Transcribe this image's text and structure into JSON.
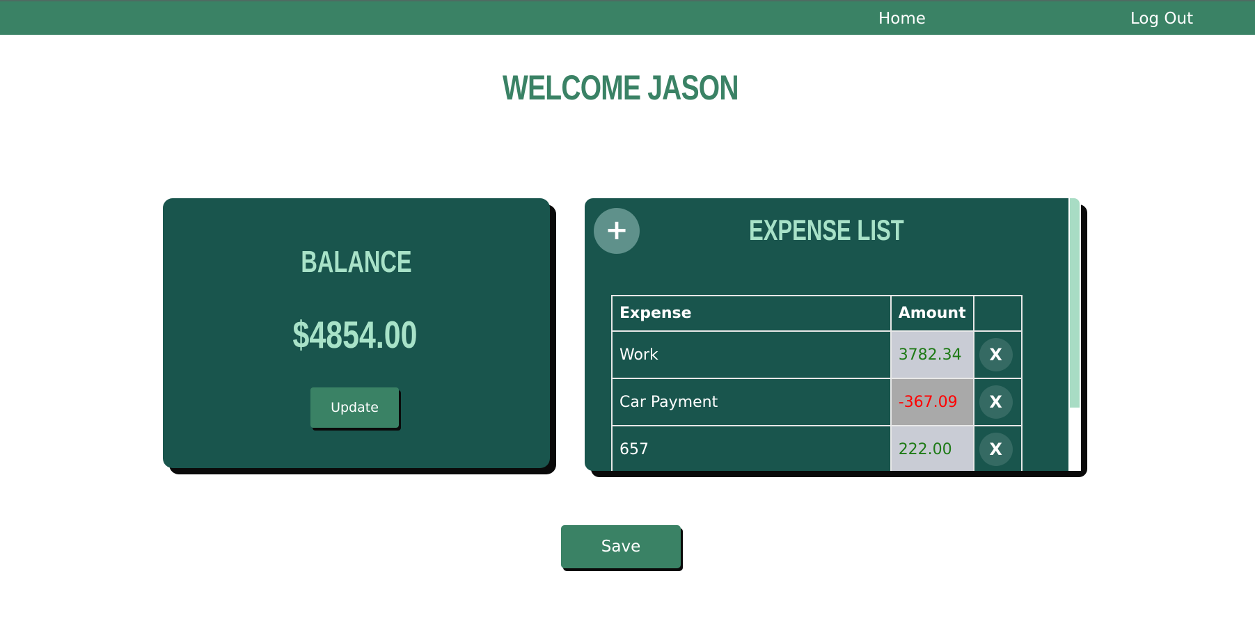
{
  "nav": {
    "home_label": "Home",
    "logout_label": "Log Out"
  },
  "page": {
    "title": "WELCOME JASON"
  },
  "balance": {
    "heading": "BALANCE",
    "amount": "$4854.00",
    "update_label": "Update"
  },
  "expenses": {
    "heading": "EXPENSE LIST",
    "add_symbol": "+",
    "columns": [
      "Expense",
      "Amount",
      ""
    ],
    "delete_symbol": "X",
    "rows": [
      {
        "name": "Work",
        "amount": "3782.34",
        "type": "positive"
      },
      {
        "name": "Car Payment",
        "amount": "-367.09",
        "type": "negative"
      },
      {
        "name": "657",
        "amount": "222.00",
        "type": "positive"
      }
    ]
  },
  "actions": {
    "save_label": "Save"
  },
  "colors": {
    "primary": "#3a8265",
    "card": "#19554d",
    "accent": "#a8e2c8",
    "positive": "#1e7a16",
    "negative": "#ff0000"
  }
}
